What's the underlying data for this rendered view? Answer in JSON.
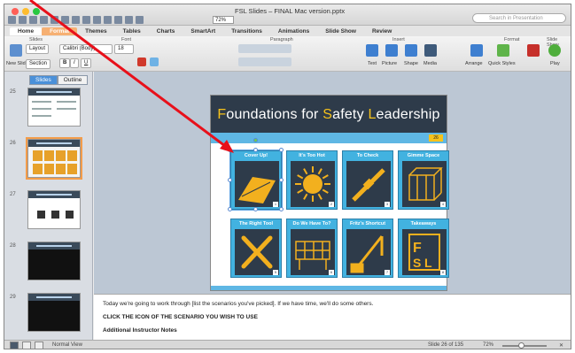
{
  "window": {
    "title": "FSL Slides – FINAL Mac version.pptx",
    "zoom": "72%",
    "search_placeholder": "Search in Presentation",
    "traffic_colors": [
      "#ff5f57",
      "#febc2e",
      "#28c840"
    ]
  },
  "ribbon": {
    "tabs": [
      {
        "label": "Home",
        "state": "home"
      },
      {
        "label": "Format",
        "state": "active"
      },
      {
        "label": "Themes",
        "state": ""
      },
      {
        "label": "Tables",
        "state": ""
      },
      {
        "label": "Charts",
        "state": ""
      },
      {
        "label": "SmartArt",
        "state": ""
      },
      {
        "label": "Transitions",
        "state": ""
      },
      {
        "label": "Animations",
        "state": ""
      },
      {
        "label": "Slide Show",
        "state": ""
      },
      {
        "label": "Review",
        "state": ""
      }
    ],
    "groups": {
      "slides": "Slides",
      "font": "Font",
      "paragraph": "Paragraph",
      "insert": "Insert",
      "format": "Format",
      "slideshow": "Slide Show"
    },
    "layout_label": "Layout",
    "new_slide_label": "New Slide",
    "section_label": "Section",
    "font_name": "Calibri (Body)",
    "font_size": "18",
    "buttons": {
      "text": "Text",
      "picture": "Picture",
      "shape": "Shape",
      "media": "Media",
      "arrange": "Arrange",
      "quick_styles": "Quick Styles",
      "play": "Play"
    }
  },
  "leftpane": {
    "tabs": [
      "Slides",
      "Outline"
    ],
    "thumbs": [
      {
        "num": "25",
        "selected": false,
        "kind": "text"
      },
      {
        "num": "26",
        "selected": true,
        "kind": "grid"
      },
      {
        "num": "27",
        "selected": false,
        "kind": "icons"
      },
      {
        "num": "28",
        "selected": false,
        "kind": "dark"
      },
      {
        "num": "29",
        "selected": false,
        "kind": "dark"
      }
    ]
  },
  "slide": {
    "title_parts": [
      {
        "text": "F",
        "hl": true
      },
      {
        "text": "oundations for ",
        "hl": false
      },
      {
        "text": "S",
        "hl": true
      },
      {
        "text": "afety ",
        "hl": false
      },
      {
        "text": "L",
        "hl": true
      },
      {
        "text": "eadership",
        "hl": false
      }
    ],
    "page_badge": "26",
    "tiles": [
      {
        "label": "Cover Up!",
        "num": "1",
        "icon": "shovel-icon"
      },
      {
        "label": "It's Too Hot",
        "num": "2",
        "icon": "sun-icon"
      },
      {
        "label": "To Check",
        "num": "3",
        "icon": "tool-icon"
      },
      {
        "label": "Gimme Space",
        "num": "4",
        "icon": "cage-icon"
      },
      {
        "label": "The Right Tool",
        "num": "5",
        "icon": "wrench-cross-icon"
      },
      {
        "label": "Do We Have To?",
        "num": "6",
        "icon": "scaffold-icon"
      },
      {
        "label": "Fritz's Shortcut",
        "num": "7",
        "icon": "crane-icon"
      },
      {
        "label": "Takeaways",
        "num": "8",
        "icon": "fsl-logo-icon"
      }
    ]
  },
  "notes": {
    "line1": "Today we're going to work through [list the scenarios you've picked]. If we have time, we'll do some others.",
    "line2": "CLICK THE ICON OF THE SCENARIO YOU WISH TO USE",
    "line3": "Additional Instructor Notes"
  },
  "status": {
    "view": "Normal View",
    "slide_pos": "Slide 26 of 135",
    "zoom": "72%"
  },
  "annotation": {
    "arrow_color": "#e8101a"
  }
}
